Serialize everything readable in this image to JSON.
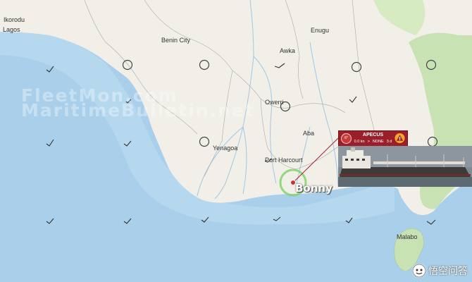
{
  "cities": {
    "ikorodu": "Ikorodu",
    "lagos": "Lagos",
    "benin_city": "Benin City",
    "enugu": "Enugu",
    "awka": "Awka",
    "owerri": "Owerri",
    "aba": "Aba",
    "yenagoa": "Yenagoa",
    "port_harcourt": "Port Harcourt",
    "malabo": "Malabo"
  },
  "highlight_label": "Bonny",
  "watermarks": [
    "FleetMon.com",
    "MaritimeBulletin.net"
  ],
  "vessel_popup": {
    "name": "APECUS",
    "speed": "0.0 kn",
    "destination_arrow": ">",
    "destination": "NONE",
    "age": "3 d",
    "left_badge": "6°"
  },
  "brand": {
    "text": "悟空问答",
    "icon": "wukong-logo-icon"
  },
  "colors": {
    "sea": "#a9cfea",
    "land": "#f1efe8",
    "forest": "#c8e2b3",
    "popup": "#9b1f2a",
    "highlight_ring": "#7fd66a",
    "marker": "#d32e2e",
    "track_line": "#a82228"
  }
}
